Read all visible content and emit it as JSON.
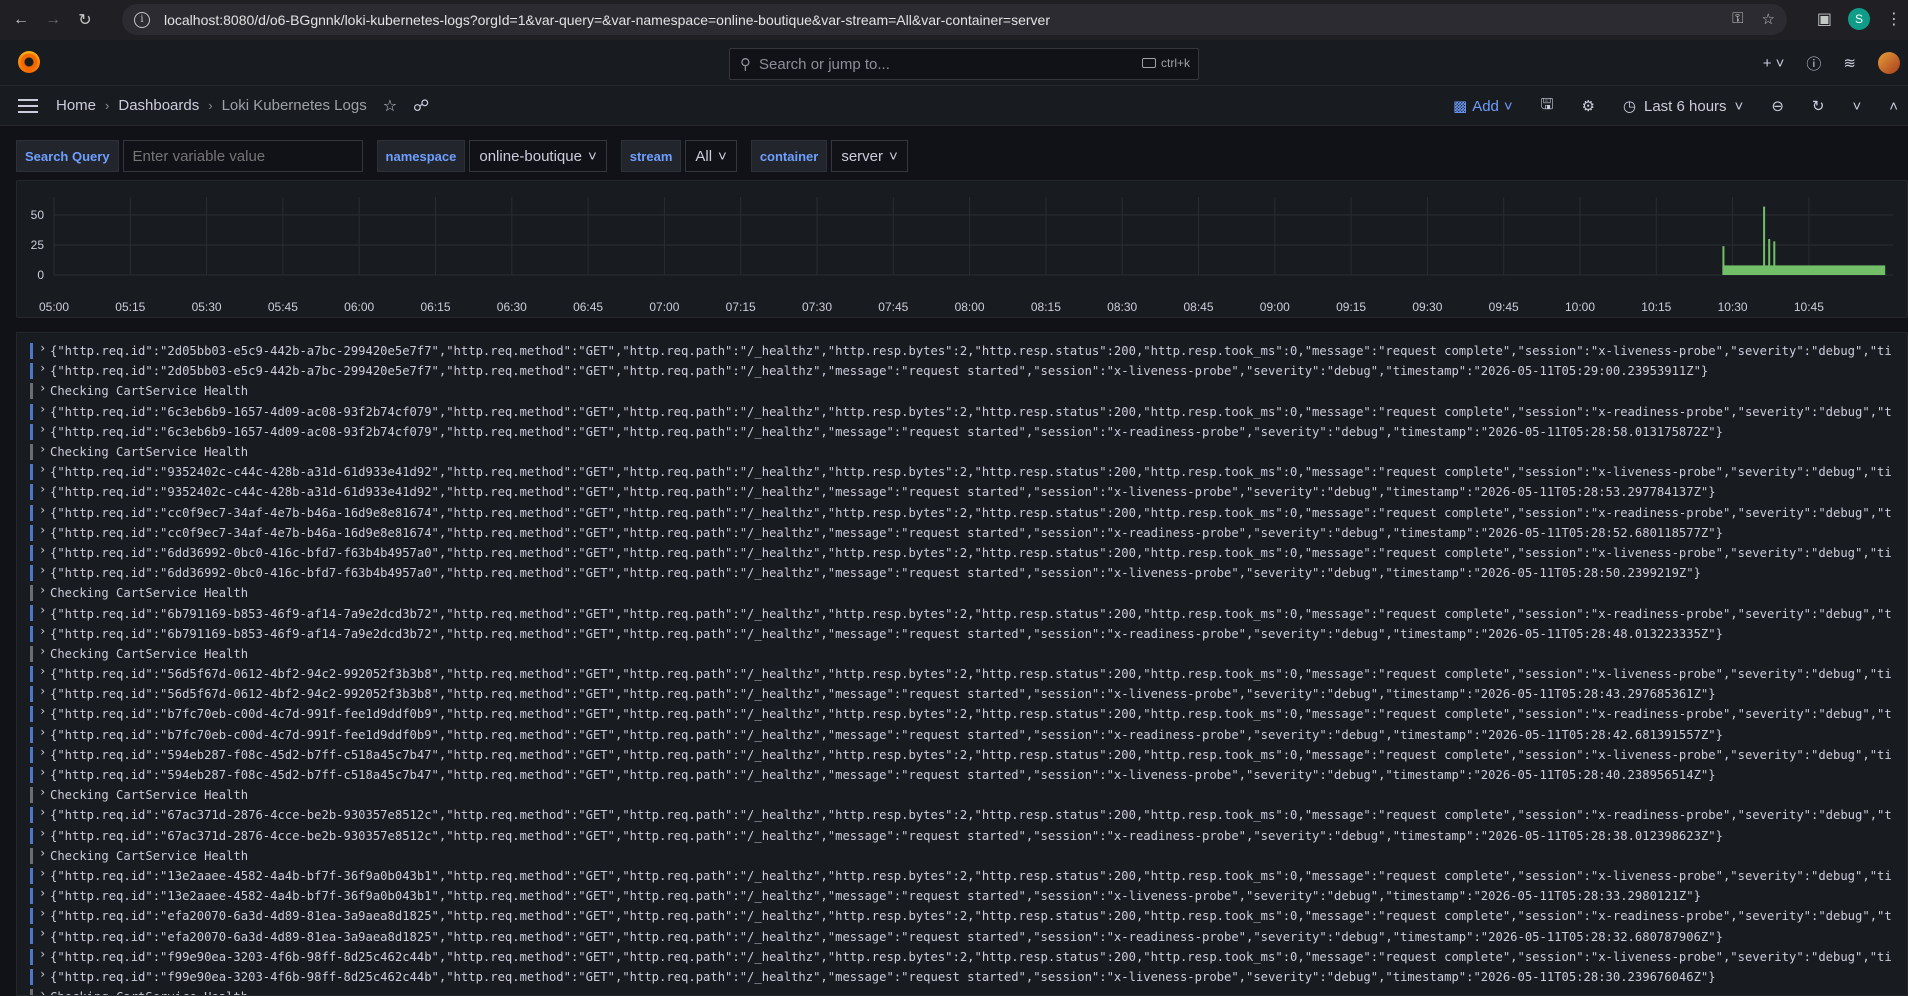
{
  "browser": {
    "url": "localhost:8080/d/o6-BGgnnk/loki-kubernetes-logs?orgId=1&var-query=&var-namespace=online-boutique&var-stream=All&var-container=server",
    "profile_initial": "S"
  },
  "topbar": {
    "search_placeholder": "Search or jump to...",
    "search_shortcut": "ctrl+k"
  },
  "breadcrumb": {
    "home": "Home",
    "dashboards": "Dashboards",
    "current": "Loki Kubernetes Logs"
  },
  "toolbar": {
    "add_label": "Add",
    "time_range": "Last 6 hours"
  },
  "variables": {
    "query_label": "Search Query",
    "query_placeholder": "Enter variable value",
    "namespace_label": "namespace",
    "namespace_value": "online-boutique",
    "stream_label": "stream",
    "stream_value": "All",
    "container_label": "container",
    "container_value": "server"
  },
  "chart_data": {
    "type": "bar",
    "y_ticks": [
      "50",
      "25",
      "0"
    ],
    "ylim": [
      0,
      65
    ],
    "x_ticks": [
      "05:00",
      "05:15",
      "05:30",
      "05:45",
      "06:00",
      "06:15",
      "06:30",
      "06:45",
      "07:00",
      "07:15",
      "07:30",
      "07:45",
      "08:00",
      "08:15",
      "08:30",
      "08:45",
      "09:00",
      "09:15",
      "09:30",
      "09:45",
      "10:00",
      "10:15",
      "10:30",
      "10:45"
    ],
    "series_color": "#73bf69",
    "spikes": [
      {
        "x": "10:28",
        "value": 24
      },
      {
        "x": "10:36",
        "value": 57
      },
      {
        "x": "10:37",
        "value": 30
      },
      {
        "x": "10:38",
        "value": 28
      }
    ],
    "baseline": {
      "from": "10:28",
      "to": "11:00",
      "value": 8
    }
  },
  "logs": [
    {
      "level": "debug",
      "text": "{\"http.req.id\":\"2d05bb03-e5c9-442b-a7bc-299420e5e7f7\",\"http.req.method\":\"GET\",\"http.req.path\":\"/_healthz\",\"http.resp.bytes\":2,\"http.resp.status\":200,\"http.resp.took_ms\":0,\"message\":\"request complete\",\"session\":\"x-liveness-probe\",\"severity\":\"debug\",\"ti"
    },
    {
      "level": "debug",
      "text": "{\"http.req.id\":\"2d05bb03-e5c9-442b-a7bc-299420e5e7f7\",\"http.req.method\":\"GET\",\"http.req.path\":\"/_healthz\",\"message\":\"request started\",\"session\":\"x-liveness-probe\",\"severity\":\"debug\",\"timestamp\":\"2026-05-11T05:29:00.23953911Z\"}"
    },
    {
      "level": "unknown",
      "text": "Checking CartService Health"
    },
    {
      "level": "debug",
      "text": "{\"http.req.id\":\"6c3eb6b9-1657-4d09-ac08-93f2b74cf079\",\"http.req.method\":\"GET\",\"http.req.path\":\"/_healthz\",\"http.resp.bytes\":2,\"http.resp.status\":200,\"http.resp.took_ms\":0,\"message\":\"request complete\",\"session\":\"x-readiness-probe\",\"severity\":\"debug\",\"t"
    },
    {
      "level": "debug",
      "text": "{\"http.req.id\":\"6c3eb6b9-1657-4d09-ac08-93f2b74cf079\",\"http.req.method\":\"GET\",\"http.req.path\":\"/_healthz\",\"message\":\"request started\",\"session\":\"x-readiness-probe\",\"severity\":\"debug\",\"timestamp\":\"2026-05-11T05:28:58.013175872Z\"}"
    },
    {
      "level": "unknown",
      "text": "Checking CartService Health"
    },
    {
      "level": "debug",
      "text": "{\"http.req.id\":\"9352402c-c44c-428b-a31d-61d933e41d92\",\"http.req.method\":\"GET\",\"http.req.path\":\"/_healthz\",\"http.resp.bytes\":2,\"http.resp.status\":200,\"http.resp.took_ms\":0,\"message\":\"request complete\",\"session\":\"x-liveness-probe\",\"severity\":\"debug\",\"ti"
    },
    {
      "level": "debug",
      "text": "{\"http.req.id\":\"9352402c-c44c-428b-a31d-61d933e41d92\",\"http.req.method\":\"GET\",\"http.req.path\":\"/_healthz\",\"message\":\"request started\",\"session\":\"x-liveness-probe\",\"severity\":\"debug\",\"timestamp\":\"2026-05-11T05:28:53.297784137Z\"}"
    },
    {
      "level": "debug",
      "text": "{\"http.req.id\":\"cc0f9ec7-34af-4e7b-b46a-16d9e8e81674\",\"http.req.method\":\"GET\",\"http.req.path\":\"/_healthz\",\"http.resp.bytes\":2,\"http.resp.status\":200,\"http.resp.took_ms\":0,\"message\":\"request complete\",\"session\":\"x-readiness-probe\",\"severity\":\"debug\",\"t"
    },
    {
      "level": "debug",
      "text": "{\"http.req.id\":\"cc0f9ec7-34af-4e7b-b46a-16d9e8e81674\",\"http.req.method\":\"GET\",\"http.req.path\":\"/_healthz\",\"message\":\"request started\",\"session\":\"x-readiness-probe\",\"severity\":\"debug\",\"timestamp\":\"2026-05-11T05:28:52.680118577Z\"}"
    },
    {
      "level": "debug",
      "text": "{\"http.req.id\":\"6dd36992-0bc0-416c-bfd7-f63b4b4957a0\",\"http.req.method\":\"GET\",\"http.req.path\":\"/_healthz\",\"http.resp.bytes\":2,\"http.resp.status\":200,\"http.resp.took_ms\":0,\"message\":\"request complete\",\"session\":\"x-liveness-probe\",\"severity\":\"debug\",\"ti"
    },
    {
      "level": "debug",
      "text": "{\"http.req.id\":\"6dd36992-0bc0-416c-bfd7-f63b4b4957a0\",\"http.req.method\":\"GET\",\"http.req.path\":\"/_healthz\",\"message\":\"request started\",\"session\":\"x-liveness-probe\",\"severity\":\"debug\",\"timestamp\":\"2026-05-11T05:28:50.2399219Z\"}"
    },
    {
      "level": "unknown",
      "text": "Checking CartService Health"
    },
    {
      "level": "debug",
      "text": "{\"http.req.id\":\"6b791169-b853-46f9-af14-7a9e2dcd3b72\",\"http.req.method\":\"GET\",\"http.req.path\":\"/_healthz\",\"http.resp.bytes\":2,\"http.resp.status\":200,\"http.resp.took_ms\":0,\"message\":\"request complete\",\"session\":\"x-readiness-probe\",\"severity\":\"debug\",\"t"
    },
    {
      "level": "debug",
      "text": "{\"http.req.id\":\"6b791169-b853-46f9-af14-7a9e2dcd3b72\",\"http.req.method\":\"GET\",\"http.req.path\":\"/_healthz\",\"message\":\"request started\",\"session\":\"x-readiness-probe\",\"severity\":\"debug\",\"timestamp\":\"2026-05-11T05:28:48.013223335Z\"}"
    },
    {
      "level": "unknown",
      "text": "Checking CartService Health"
    },
    {
      "level": "debug",
      "text": "{\"http.req.id\":\"56d5f67d-0612-4bf2-94c2-992052f3b3b8\",\"http.req.method\":\"GET\",\"http.req.path\":\"/_healthz\",\"http.resp.bytes\":2,\"http.resp.status\":200,\"http.resp.took_ms\":0,\"message\":\"request complete\",\"session\":\"x-liveness-probe\",\"severity\":\"debug\",\"ti"
    },
    {
      "level": "debug",
      "text": "{\"http.req.id\":\"56d5f67d-0612-4bf2-94c2-992052f3b3b8\",\"http.req.method\":\"GET\",\"http.req.path\":\"/_healthz\",\"message\":\"request started\",\"session\":\"x-liveness-probe\",\"severity\":\"debug\",\"timestamp\":\"2026-05-11T05:28:43.297685361Z\"}"
    },
    {
      "level": "debug",
      "text": "{\"http.req.id\":\"b7fc70eb-c00d-4c7d-991f-fee1d9ddf0b9\",\"http.req.method\":\"GET\",\"http.req.path\":\"/_healthz\",\"http.resp.bytes\":2,\"http.resp.status\":200,\"http.resp.took_ms\":0,\"message\":\"request complete\",\"session\":\"x-readiness-probe\",\"severity\":\"debug\",\"t"
    },
    {
      "level": "debug",
      "text": "{\"http.req.id\":\"b7fc70eb-c00d-4c7d-991f-fee1d9ddf0b9\",\"http.req.method\":\"GET\",\"http.req.path\":\"/_healthz\",\"message\":\"request started\",\"session\":\"x-readiness-probe\",\"severity\":\"debug\",\"timestamp\":\"2026-05-11T05:28:42.681391557Z\"}"
    },
    {
      "level": "debug",
      "text": "{\"http.req.id\":\"594eb287-f08c-45d2-b7ff-c518a45c7b47\",\"http.req.method\":\"GET\",\"http.req.path\":\"/_healthz\",\"http.resp.bytes\":2,\"http.resp.status\":200,\"http.resp.took_ms\":0,\"message\":\"request complete\",\"session\":\"x-liveness-probe\",\"severity\":\"debug\",\"ti"
    },
    {
      "level": "debug",
      "text": "{\"http.req.id\":\"594eb287-f08c-45d2-b7ff-c518a45c7b47\",\"http.req.method\":\"GET\",\"http.req.path\":\"/_healthz\",\"message\":\"request started\",\"session\":\"x-liveness-probe\",\"severity\":\"debug\",\"timestamp\":\"2026-05-11T05:28:40.238956514Z\"}"
    },
    {
      "level": "unknown",
      "text": "Checking CartService Health"
    },
    {
      "level": "debug",
      "text": "{\"http.req.id\":\"67ac371d-2876-4cce-be2b-930357e8512c\",\"http.req.method\":\"GET\",\"http.req.path\":\"/_healthz\",\"http.resp.bytes\":2,\"http.resp.status\":200,\"http.resp.took_ms\":0,\"message\":\"request complete\",\"session\":\"x-readiness-probe\",\"severity\":\"debug\",\"t"
    },
    {
      "level": "debug",
      "text": "{\"http.req.id\":\"67ac371d-2876-4cce-be2b-930357e8512c\",\"http.req.method\":\"GET\",\"http.req.path\":\"/_healthz\",\"message\":\"request started\",\"session\":\"x-readiness-probe\",\"severity\":\"debug\",\"timestamp\":\"2026-05-11T05:28:38.012398623Z\"}"
    },
    {
      "level": "unknown",
      "text": "Checking CartService Health"
    },
    {
      "level": "debug",
      "text": "{\"http.req.id\":\"13e2aaee-4582-4a4b-bf7f-36f9a0b043b1\",\"http.req.method\":\"GET\",\"http.req.path\":\"/_healthz\",\"http.resp.bytes\":2,\"http.resp.status\":200,\"http.resp.took_ms\":0,\"message\":\"request complete\",\"session\":\"x-liveness-probe\",\"severity\":\"debug\",\"ti"
    },
    {
      "level": "debug",
      "text": "{\"http.req.id\":\"13e2aaee-4582-4a4b-bf7f-36f9a0b043b1\",\"http.req.method\":\"GET\",\"http.req.path\":\"/_healthz\",\"message\":\"request started\",\"session\":\"x-liveness-probe\",\"severity\":\"debug\",\"timestamp\":\"2026-05-11T05:28:33.2980121Z\"}"
    },
    {
      "level": "debug",
      "text": "{\"http.req.id\":\"efa20070-6a3d-4d89-81ea-3a9aea8d1825\",\"http.req.method\":\"GET\",\"http.req.path\":\"/_healthz\",\"http.resp.bytes\":2,\"http.resp.status\":200,\"http.resp.took_ms\":0,\"message\":\"request complete\",\"session\":\"x-readiness-probe\",\"severity\":\"debug\",\"t"
    },
    {
      "level": "debug",
      "text": "{\"http.req.id\":\"efa20070-6a3d-4d89-81ea-3a9aea8d1825\",\"http.req.method\":\"GET\",\"http.req.path\":\"/_healthz\",\"message\":\"request started\",\"session\":\"x-readiness-probe\",\"severity\":\"debug\",\"timestamp\":\"2026-05-11T05:28:32.680787906Z\"}"
    },
    {
      "level": "debug",
      "text": "{\"http.req.id\":\"f99e90ea-3203-4f6b-98ff-8d25c462c44b\",\"http.req.method\":\"GET\",\"http.req.path\":\"/_healthz\",\"http.resp.bytes\":2,\"http.resp.status\":200,\"http.resp.took_ms\":0,\"message\":\"request complete\",\"session\":\"x-liveness-probe\",\"severity\":\"debug\",\"ti"
    },
    {
      "level": "debug",
      "text": "{\"http.req.id\":\"f99e90ea-3203-4f6b-98ff-8d25c462c44b\",\"http.req.method\":\"GET\",\"http.req.path\":\"/_healthz\",\"message\":\"request started\",\"session\":\"x-liveness-probe\",\"severity\":\"debug\",\"timestamp\":\"2026-05-11T05:28:30.239676046Z\"}"
    },
    {
      "level": "unknown",
      "text": "Checking CartService Health"
    }
  ]
}
